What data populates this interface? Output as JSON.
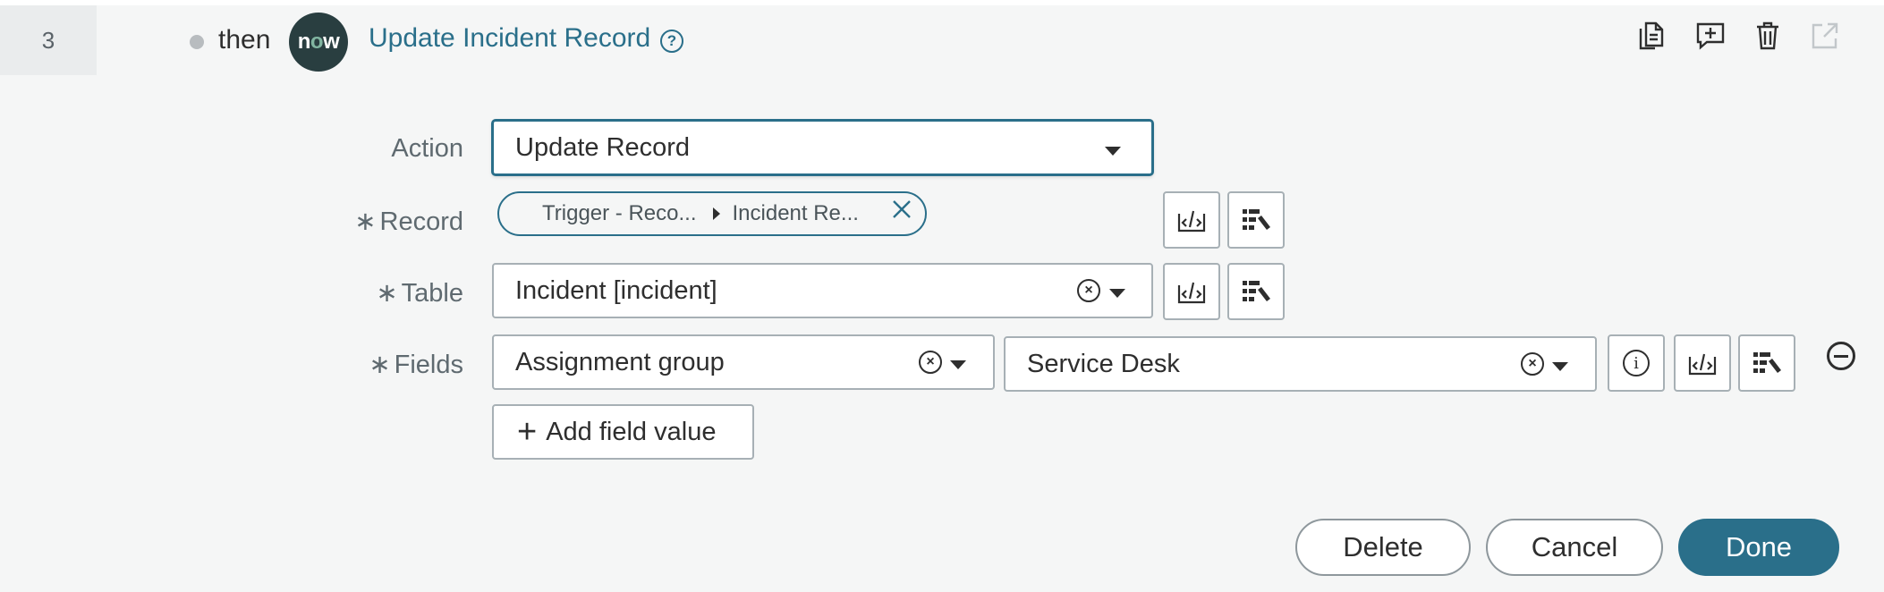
{
  "step": {
    "number": "3",
    "connector": "then",
    "logo_text": "now",
    "title": "Update Incident Record",
    "help_icon": "question-circle-icon",
    "toolbar_icons": [
      "copy-icon",
      "add-comment-icon",
      "trash-icon",
      "open-external-icon"
    ]
  },
  "form": {
    "action": {
      "label": "Action",
      "value": "Update Record"
    },
    "record": {
      "label": "Record",
      "pill_part1": "Trigger - Reco...",
      "pill_part2": "Incident Re..."
    },
    "table": {
      "label": "Table",
      "value": "Incident [incident]"
    },
    "fields": {
      "label": "Fields",
      "field_name": "Assignment group",
      "field_value": "Service Desk"
    },
    "required_marker": "∗",
    "add_field_label": "Add field value"
  },
  "buttons": {
    "delete": "Delete",
    "cancel": "Cancel",
    "done": "Done"
  },
  "colors": {
    "accent": "#2a6f8a",
    "background": "#f5f6f6",
    "logo_bg": "#293e40"
  }
}
